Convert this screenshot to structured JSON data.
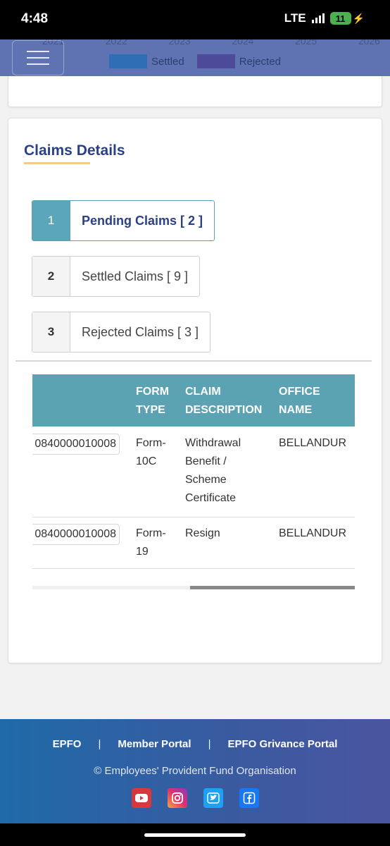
{
  "status_bar": {
    "time": "4:48",
    "network": "LTE",
    "battery": "11"
  },
  "chart_legend": {
    "years": [
      "2021",
      "2022",
      "2023",
      "2024",
      "2025",
      "2026"
    ],
    "items": [
      {
        "label": "Settled",
        "color": "#2f6db5"
      },
      {
        "label": "Rejected",
        "color": "#4e4a9a"
      }
    ]
  },
  "claims": {
    "title": "Claims Details",
    "tabs": [
      {
        "num": "1",
        "label": "Pending Claims [ 2 ]"
      },
      {
        "num": "2",
        "label": "Settled Claims [ 9 ]"
      },
      {
        "num": "3",
        "label": "Rejected Claims [ 3 ]"
      }
    ],
    "table": {
      "headers": {
        "form_type": [
          "FORM",
          "TYPE"
        ],
        "claim_description": [
          "CLAIM",
          "DESCRIPTION"
        ],
        "office_name": [
          "OFFICE",
          "NAME"
        ]
      },
      "rows": [
        {
          "claim_id": "0840000010008",
          "form_type": [
            "Form-",
            "10C"
          ],
          "description": [
            "Withdrawal",
            "Benefit /",
            "Scheme",
            "Certificate"
          ],
          "office": "BELLANDUR"
        },
        {
          "claim_id": "0840000010008",
          "form_type": [
            "Form-",
            "19"
          ],
          "description": [
            "Resign"
          ],
          "office": "BELLANDUR"
        }
      ]
    }
  },
  "footer": {
    "links": [
      "EPFO",
      "Member Portal",
      "EPFO Grivance Portal"
    ],
    "separator": "|",
    "copyright": "© Employees' Provident Fund Organisation",
    "social_colors": {
      "youtube": "#d9363e",
      "instagram": "#c13584",
      "twitter": "#1da1f2",
      "facebook": "#1877f2"
    }
  }
}
